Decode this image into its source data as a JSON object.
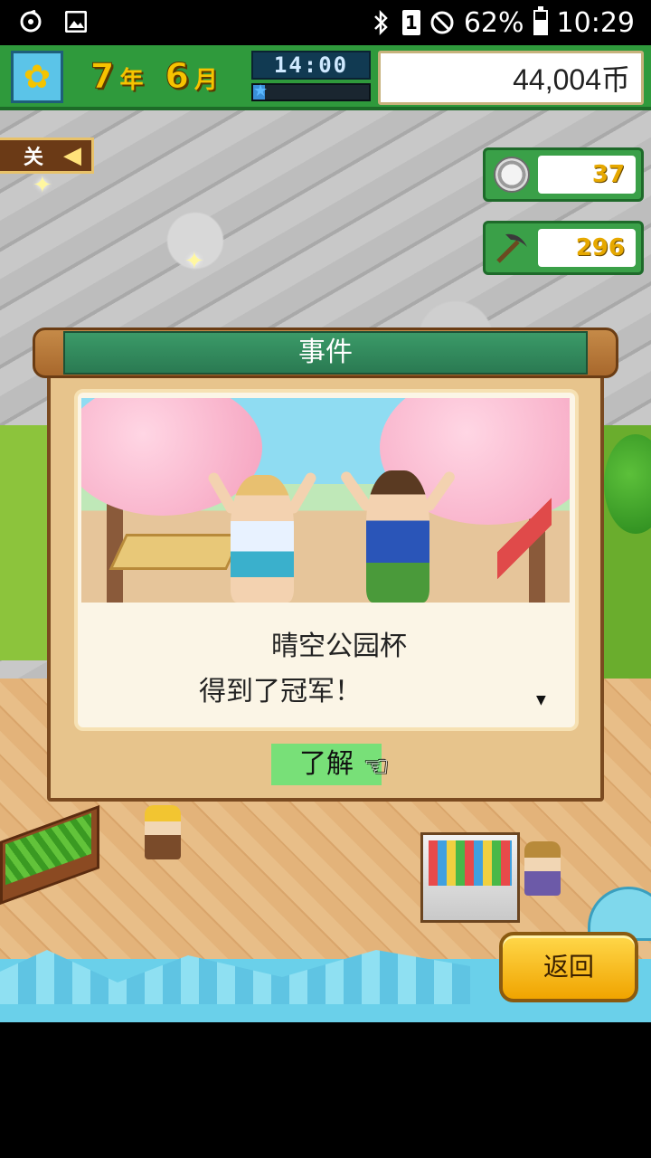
{
  "status_bar": {
    "battery_percent": "62%",
    "battery_level": 0.62,
    "time": "10:29",
    "sim_label": "1",
    "icons": [
      "sync-icon",
      "gallery-icon",
      "bluetooth-icon",
      "sim-icon",
      "dnd-icon",
      "battery-icon"
    ]
  },
  "hud": {
    "season_icon": "sunflower-icon",
    "year_num": "7",
    "year_unit": "年",
    "month_num": "6",
    "month_unit": "月",
    "clock": "14:00",
    "day_progress": 0.1,
    "money": "44,004币"
  },
  "side_tag": {
    "label": "关",
    "arrow": "◀"
  },
  "resources": {
    "medals": "37",
    "medal_icon": "medal-icon",
    "pickaxe": "296",
    "pickaxe_icon": "pickaxe-icon"
  },
  "dialog": {
    "title": "事件",
    "message_line1": "晴空公园杯",
    "message_line2": "得到了冠军！",
    "ok_label": "了解",
    "more_indicator": "▼"
  },
  "back_button": {
    "label": "返回"
  },
  "colors": {
    "hud_green": "#2f9a3c",
    "title_green": "#2a7a52",
    "ok_green": "#78e078",
    "back_yellow": "#f0a400",
    "resource_text": "#e6a800"
  }
}
